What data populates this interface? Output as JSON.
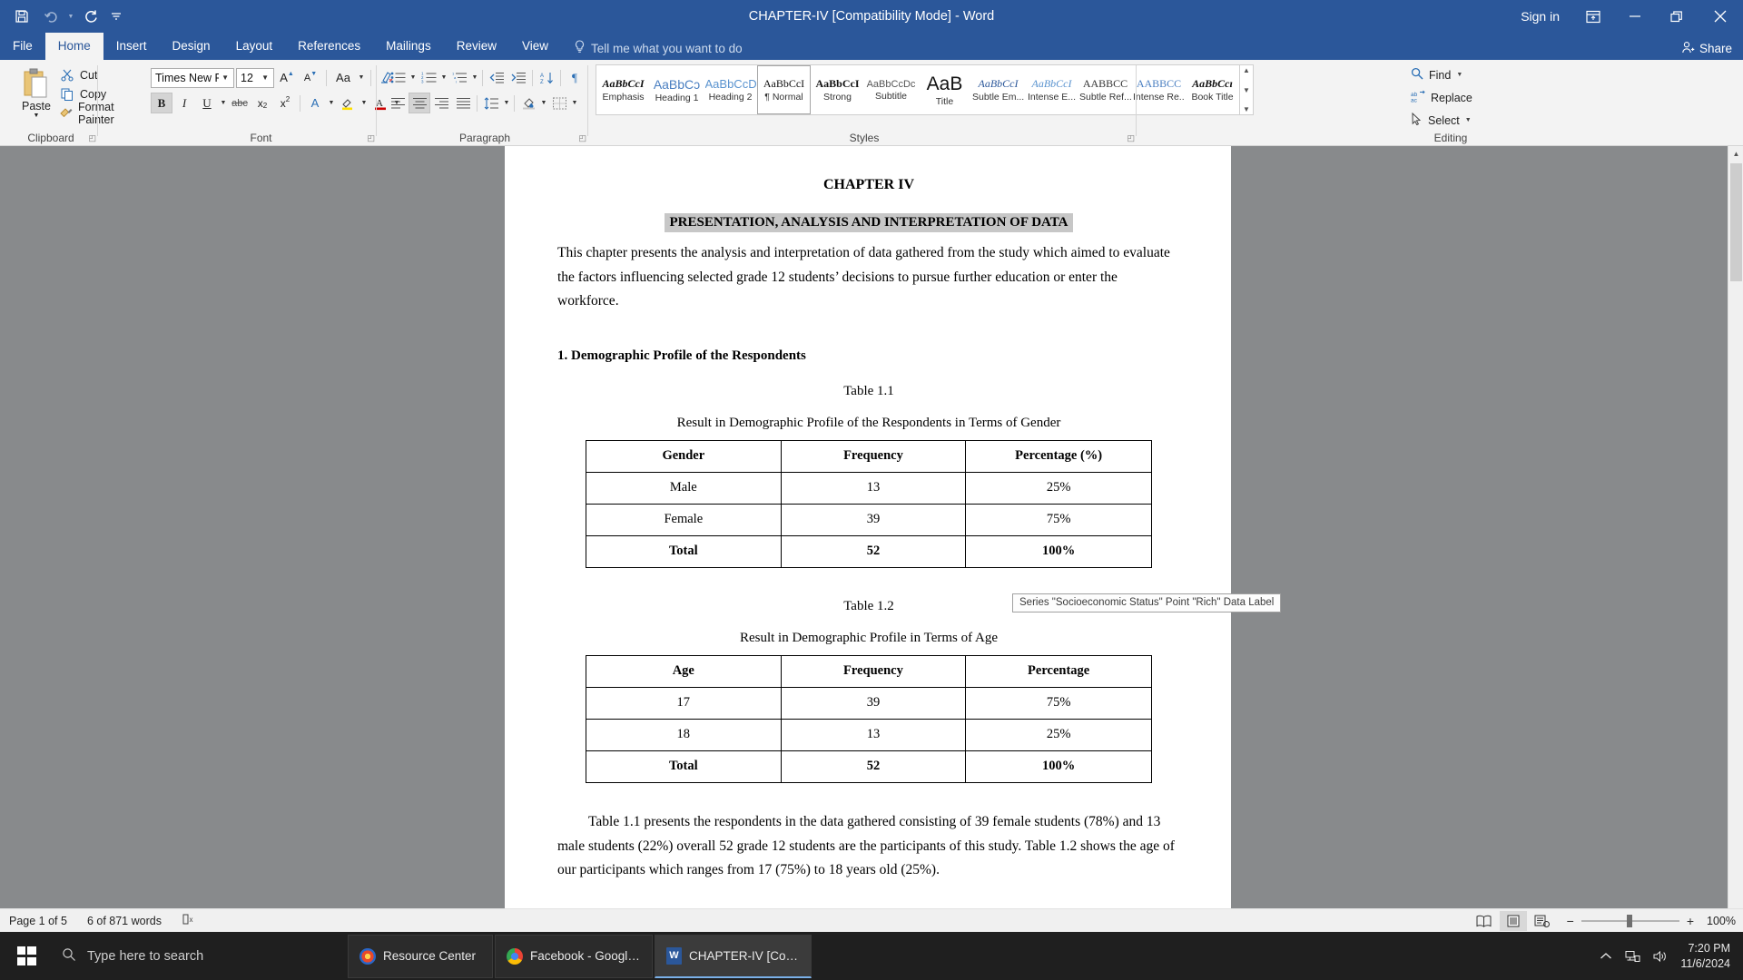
{
  "titlebar": {
    "quick_access": [
      {
        "name": "save-icon",
        "glyph": "save"
      },
      {
        "name": "undo-icon",
        "glyph": "undo"
      },
      {
        "name": "redo-icon",
        "glyph": "redo"
      },
      {
        "name": "customize-qat-icon",
        "glyph": "chevron-down"
      }
    ],
    "document_title": "CHAPTER-IV [Compatibility Mode]  -  Word",
    "sign_in": "Sign in",
    "ribbon_display_options": "ribbon-display-options-icon",
    "minimize": "minimize-icon",
    "restore": "restore-icon",
    "close": "close-icon"
  },
  "ribbon": {
    "tabs": [
      {
        "label": "File",
        "active": false
      },
      {
        "label": "Home",
        "active": true
      },
      {
        "label": "Insert",
        "active": false
      },
      {
        "label": "Design",
        "active": false
      },
      {
        "label": "Layout",
        "active": false
      },
      {
        "label": "References",
        "active": false
      },
      {
        "label": "Mailings",
        "active": false
      },
      {
        "label": "Review",
        "active": false
      },
      {
        "label": "View",
        "active": false
      }
    ],
    "tell_me": "Tell me what you want to do",
    "share": "Share",
    "groups": {
      "clipboard": {
        "label": "Clipboard",
        "paste": "Paste",
        "items": [
          {
            "label": "Cut",
            "icon": "scissors-icon"
          },
          {
            "label": "Copy",
            "icon": "copy-icon"
          },
          {
            "label": "Format Painter",
            "icon": "format-painter-icon"
          }
        ]
      },
      "font": {
        "label": "Font",
        "font_name": "Times New Ro",
        "font_size": "12",
        "buttons": [
          "grow-font-icon",
          "shrink-font-icon",
          "change-case-icon",
          "clear-formatting-icon",
          "bold-icon",
          "italic-icon",
          "underline-icon",
          "strikethrough-icon",
          "subscript-icon",
          "superscript-icon",
          "text-effects-icon",
          "text-highlight-color-icon",
          "font-color-icon"
        ]
      },
      "paragraph": {
        "label": "Paragraph"
      },
      "styles": {
        "label": "Styles",
        "items": [
          {
            "preview": "AaBbCcI",
            "name": "Emphasis",
            "selected": false
          },
          {
            "preview": "AaBbCɔ",
            "name": "Heading 1",
            "selected": false
          },
          {
            "preview": "AaBbCcD",
            "name": "Heading 2",
            "selected": false
          },
          {
            "preview": "AaBbCcI",
            "name": "¶ Normal",
            "selected": true
          },
          {
            "preview": "AaBbCcI",
            "name": "Strong",
            "selected": false
          },
          {
            "preview": "AaBbCcDc",
            "name": "Subtitle",
            "selected": false
          },
          {
            "preview": "AaB",
            "name": "Title",
            "selected": false
          },
          {
            "preview": "AaBbCcI",
            "name": "Subtle Em...",
            "selected": false
          },
          {
            "preview": "AaBbCcI",
            "name": "Intense E...",
            "selected": false
          },
          {
            "preview": "AABBCC",
            "name": "Subtle Ref...",
            "selected": false
          },
          {
            "preview": "AABBCC",
            "name": "Intense Re...",
            "selected": false
          },
          {
            "preview": "AaBbCcı",
            "name": "Book Title",
            "selected": false
          }
        ]
      },
      "editing": {
        "label": "Editing",
        "items": [
          {
            "label": "Find",
            "icon": "search-icon"
          },
          {
            "label": "Replace",
            "icon": "replace-icon"
          },
          {
            "label": "Select",
            "icon": "select-pointer-icon"
          }
        ]
      }
    }
  },
  "document": {
    "chapter_heading": "CHAPTER IV",
    "main_title": "PRESENTATION, ANALYSIS AND INTERPRETATION OF DATA",
    "intro_paragraph": "This chapter presents the analysis and interpretation of data gathered from the study which aimed to evaluate the factors influencing selected grade 12 students’ decisions to pursue further education or enter the workforce.",
    "section_heading": "1. Demographic Profile of the Respondents",
    "table1": {
      "caption": "Table 1.1",
      "subtitle": "Result in Demographic Profile of the Respondents in Terms of Gender",
      "headers": [
        "Gender",
        "Frequency",
        "Percentage (%)"
      ],
      "rows": [
        [
          "Male",
          "13",
          "25%"
        ],
        [
          "Female",
          "39",
          "75%"
        ],
        [
          "Total",
          "52",
          "100%"
        ]
      ]
    },
    "table2": {
      "caption": "Table 1.2",
      "subtitle": "Result in Demographic Profile in Terms of Age",
      "headers": [
        "Age",
        "Frequency",
        "Percentage"
      ],
      "rows": [
        [
          "17",
          "39",
          "75%"
        ],
        [
          "18",
          "13",
          "25%"
        ],
        [
          "Total",
          "52",
          "100%"
        ]
      ]
    },
    "closing_paragraph": "Table 1.1 presents the respondents in the data gathered consisting of 39 female students (78%) and 13 male students (22%) overall 52 grade 12 students are the participants of this study. Table 1.2 shows the age of our participants which ranges from 17 (75%) to 18 years old (25%)."
  },
  "tooltip": {
    "text": "Series \"Socioeconomic Status\" Point \"Rich\" Data Label"
  },
  "statusbar": {
    "page": "Page 1 of 5",
    "words": "6 of 871 words",
    "proofing_icon": "proofing-errors-icon",
    "views": [
      {
        "name": "read-mode-icon",
        "active": false
      },
      {
        "name": "print-layout-icon",
        "active": true
      },
      {
        "name": "web-layout-icon",
        "active": false
      }
    ],
    "zoom_out": "−",
    "zoom_in": "+",
    "zoom_level": "100%"
  },
  "taskbar": {
    "search_placeholder": "Type here to search",
    "items": [
      {
        "label": "Resource Center",
        "icon": "resource-center-icon",
        "active": false
      },
      {
        "label": "Facebook - Google ...",
        "icon": "chrome-icon",
        "active": false
      },
      {
        "label": "CHAPTER-IV [Com...",
        "icon": "word-icon",
        "active": true
      }
    ],
    "tray": {
      "show_hidden": "show-hidden-icons-icon",
      "network": "network-icon",
      "volume": "volume-icon",
      "time": "7:20 PM",
      "date": "11/6/2024"
    }
  }
}
